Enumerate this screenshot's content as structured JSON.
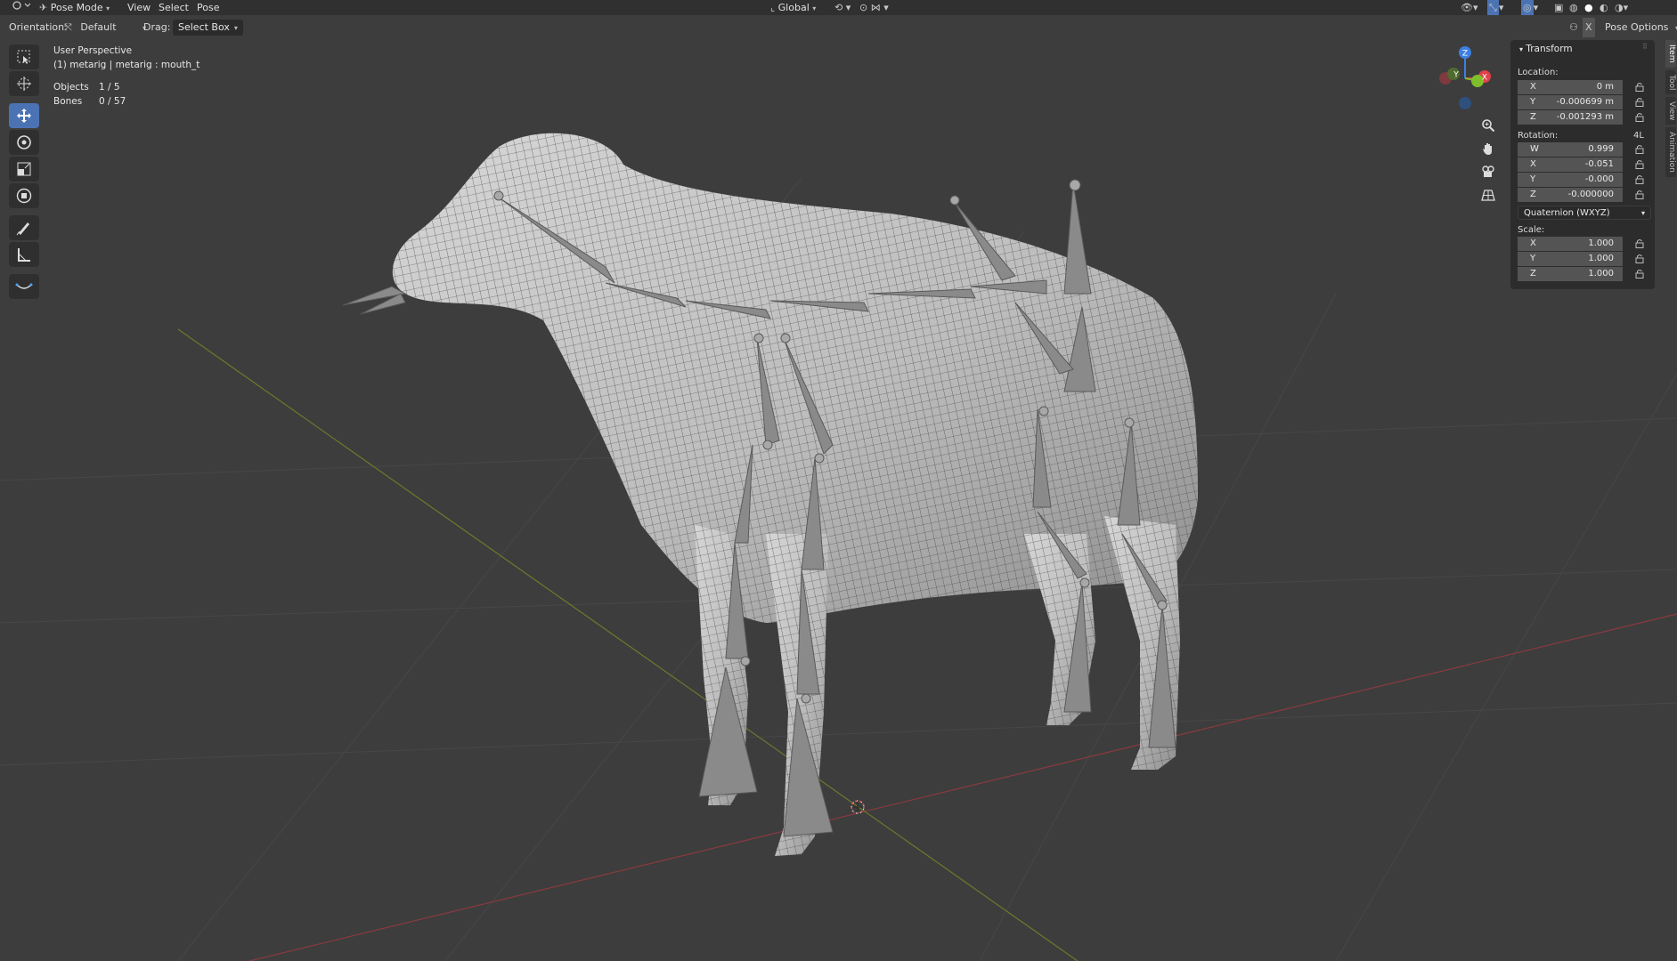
{
  "header": {
    "mode": "Pose Mode",
    "menus": [
      "View",
      "Select",
      "Pose"
    ],
    "transform_orientation": "Global"
  },
  "tool_header": {
    "orientation_label": "Orientation:",
    "orientation_value": "Default",
    "drag_label": "Drag:",
    "drag_value": "Select Box",
    "pose_options": "Pose Options"
  },
  "viewport": {
    "perspective": "User Perspective",
    "active_object": "(1) metarig | metarig : mouth_t",
    "stats": [
      {
        "label": "Objects",
        "value": "1 / 5"
      },
      {
        "label": "Bones",
        "value": "0 / 57"
      }
    ],
    "gizmo_axes": {
      "x": "X",
      "y": "Y",
      "z": "Z"
    }
  },
  "tools": [
    {
      "name": "select-box-tool",
      "icon": "select-box-icon"
    },
    {
      "name": "cursor-tool",
      "icon": "cursor-icon"
    },
    {
      "name": "move-tool",
      "icon": "move-icon",
      "active": true
    },
    {
      "name": "rotate-tool",
      "icon": "rotate-icon"
    },
    {
      "name": "scale-tool",
      "icon": "scale-icon"
    },
    {
      "name": "transform-tool",
      "icon": "transform-icon"
    },
    {
      "name": "annotate-tool",
      "icon": "annotate-icon"
    },
    {
      "name": "measure-tool",
      "icon": "measure-icon"
    },
    {
      "name": "relax-tool",
      "icon": "relax-icon"
    }
  ],
  "transform": {
    "title": "Transform",
    "location_label": "Location:",
    "location": [
      {
        "axis": "X",
        "value": "0 m"
      },
      {
        "axis": "Y",
        "value": "-0.000699 m"
      },
      {
        "axis": "Z",
        "value": "-0.001293 m"
      }
    ],
    "rotation_label": "Rotation:",
    "rotation_lock_label": "4L",
    "rotation": [
      {
        "axis": "W",
        "value": "0.999"
      },
      {
        "axis": "X",
        "value": "-0.051"
      },
      {
        "axis": "Y",
        "value": "-0.000"
      },
      {
        "axis": "Z",
        "value": "-0.000000"
      }
    ],
    "rotation_mode": "Quaternion (WXYZ)",
    "scale_label": "Scale:",
    "scale": [
      {
        "axis": "X",
        "value": "1.000"
      },
      {
        "axis": "Y",
        "value": "1.000"
      },
      {
        "axis": "Z",
        "value": "1.000"
      }
    ]
  },
  "side_tabs": [
    "Item",
    "Tool",
    "View",
    "Animation"
  ],
  "colors": {
    "viewport_bg": "#3d3d3d",
    "header_bg": "#303030",
    "active_tool": "#4b73b4",
    "axis_x": "#e0414a",
    "axis_y": "#7fbf2a",
    "axis_z": "#3d7fe0"
  }
}
